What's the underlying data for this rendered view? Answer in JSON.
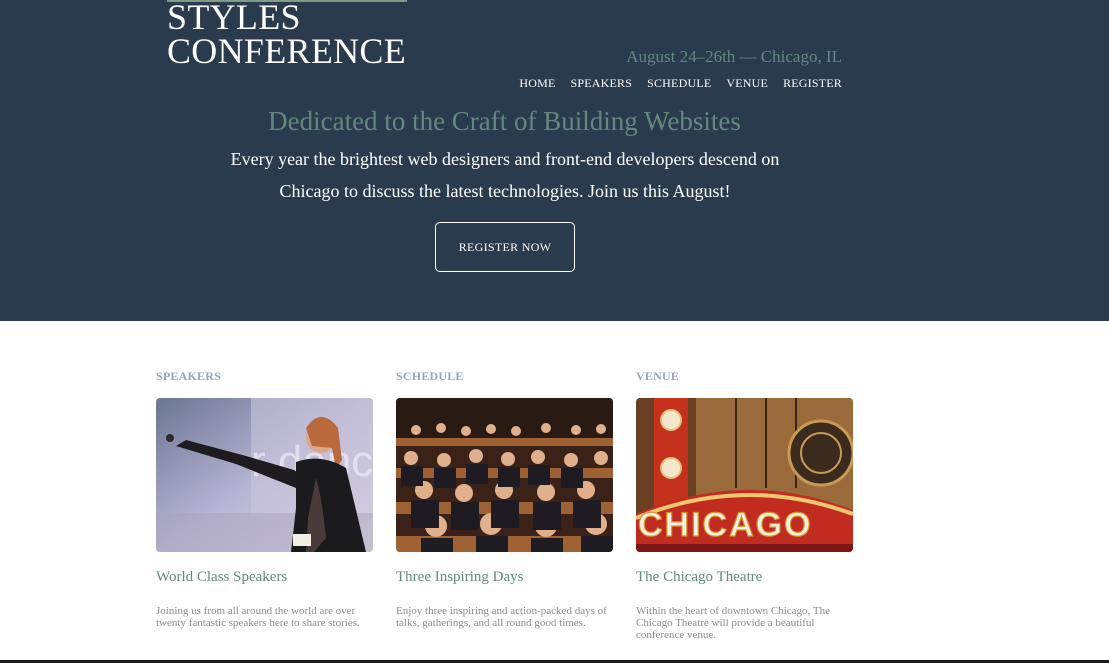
{
  "header": {
    "logo_line1": "STYLES",
    "logo_line2": "CONFERENCE",
    "dates": "August 24–26th — Chicago, IL",
    "nav": [
      "HOME",
      "SPEAKERS",
      "SCHEDULE",
      "VENUE",
      "REGISTER"
    ]
  },
  "hero": {
    "tagline": "Dedicated to the Craft of Building Websites",
    "lede": "Every year the brightest web designers and front-end developers descend on Chicago to discuss the latest technologies. Join us this August!",
    "cta_label": "REGISTER NOW"
  },
  "features": [
    {
      "kicker": "SPEAKERS",
      "title": "World Class Speakers",
      "text": "Joining us from all around the world are over twenty fantastic speakers here to share stories."
    },
    {
      "kicker": "SCHEDULE",
      "title": "Three Inspiring Days",
      "text": "Enjoy three inspiring and action-packed days of talks, gatherings, and all round good times."
    },
    {
      "kicker": "VENUE",
      "title": "The Chicago Theatre",
      "text": "Within the heart of downtown Chicago, The Chicago Theatre will provide a beautiful conference venue."
    }
  ],
  "colors": {
    "hero_bg": "#2a3b4d",
    "accent": "#648880",
    "kicker": "#9aa6b4",
    "body_text": "#8c8c8c"
  }
}
